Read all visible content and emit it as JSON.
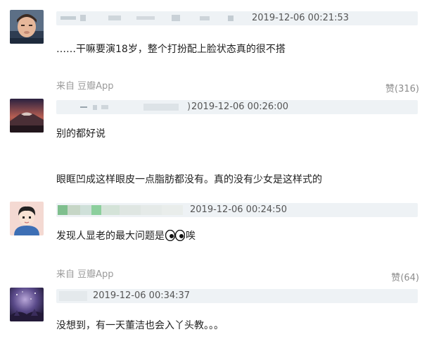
{
  "comments": [
    {
      "avatar": "avatar-boy-photo",
      "timestamp": "2019-12-06 00:21:53",
      "paragraphs": [
        "……干嘛要演18岁，整个打扮配上脸状态真的很不搭"
      ],
      "source": "来自 豆瓣App",
      "like_label": "赞",
      "like_count": "(316)"
    },
    {
      "avatar": "avatar-mountain-photo",
      "paren": ")",
      "timestamp": "2019-12-06 00:26:00",
      "paragraphs": [
        "别的都好说",
        "眼眶凹成这样眼皮一点脂肪都没有。真的没有少女是这样式的"
      ]
    },
    {
      "avatar": "avatar-cartoon-boy",
      "timestamp": "2019-12-06 00:24:50",
      "text_before": "发现人显老的最大问题是",
      "emoji": "eyes-emoji",
      "text_after": "唉",
      "source": "来自 豆瓣App",
      "like_label": "赞",
      "like_count": "(64)"
    },
    {
      "avatar": "avatar-night-sky",
      "timestamp": "2019-12-06 00:34:37",
      "paragraphs": [
        "没想到，有一天董洁也会入丫头教。。。"
      ]
    }
  ],
  "colors": {
    "meta_bar": "#eef2f5",
    "muted_text": "#9a9a9a",
    "body_text": "#1f1f1f"
  }
}
